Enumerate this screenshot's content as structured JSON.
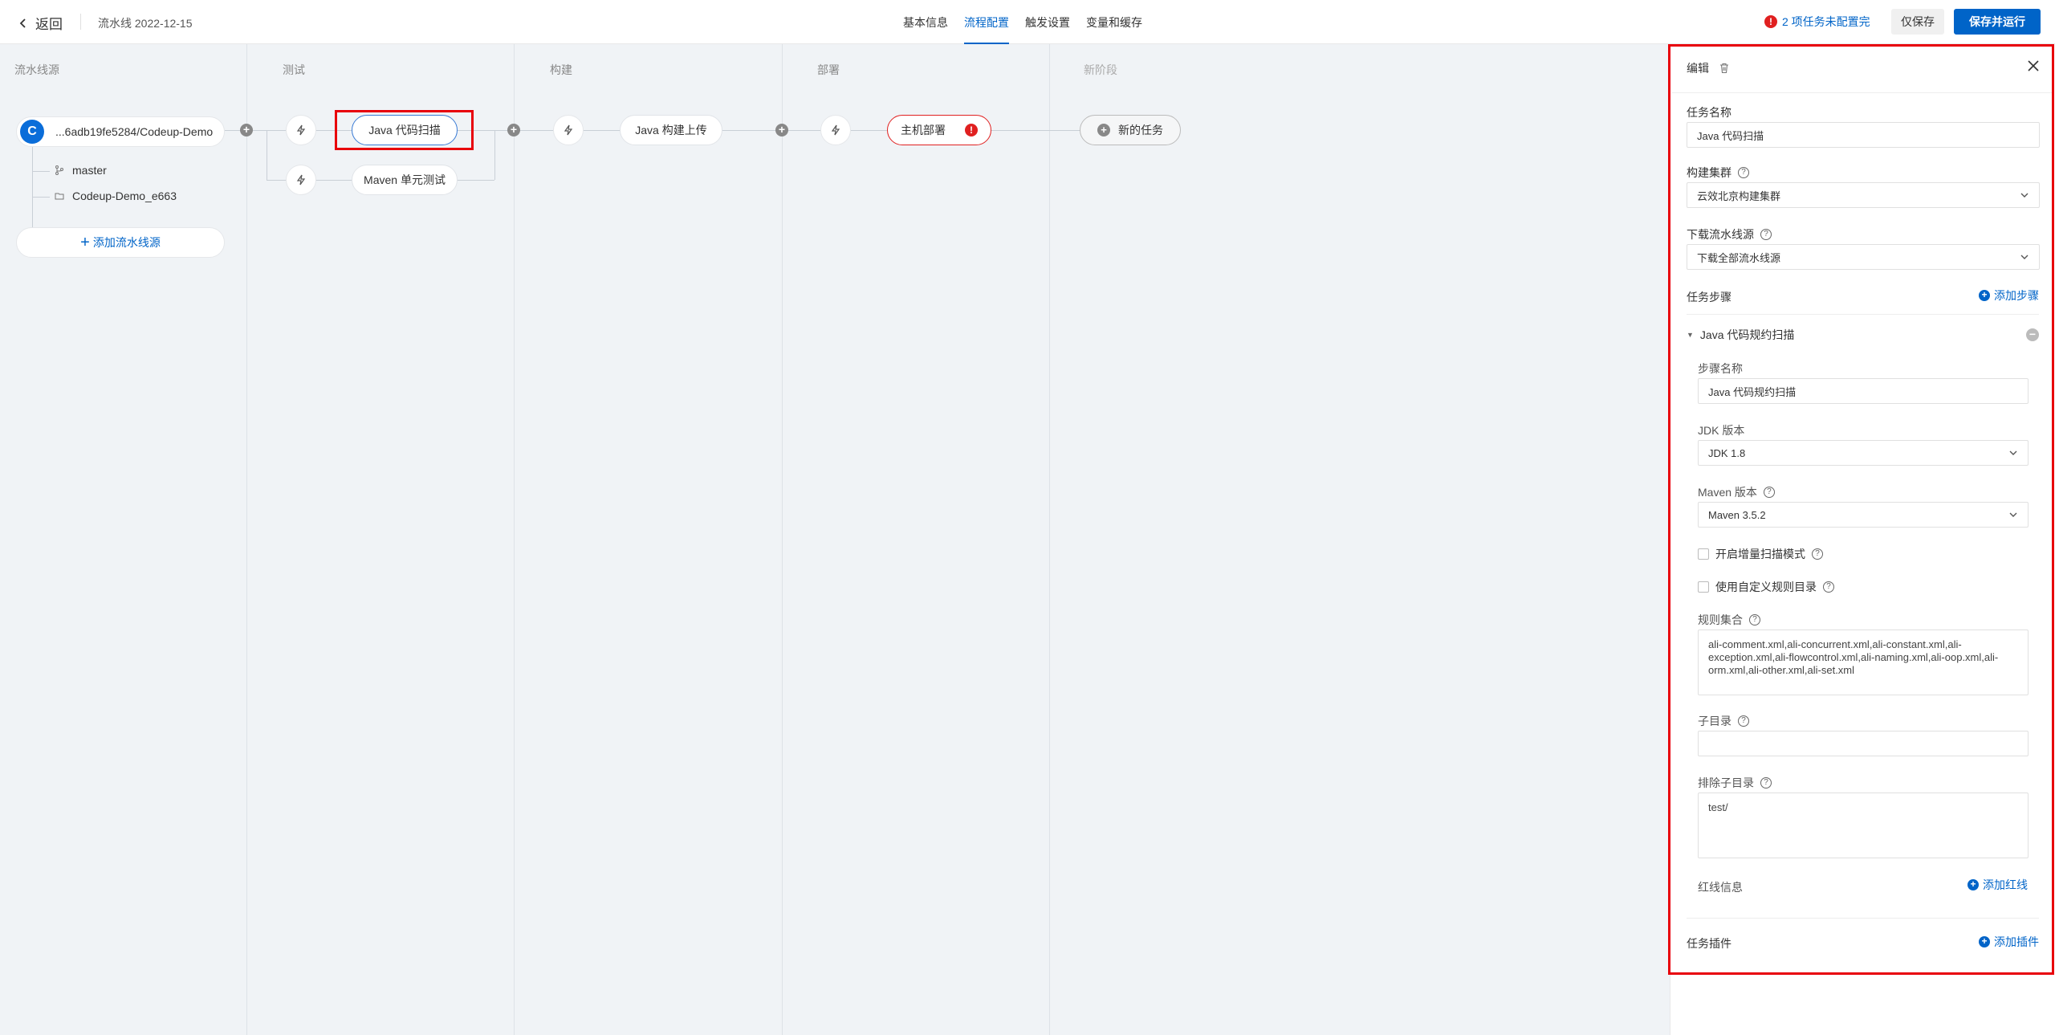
{
  "header": {
    "back_label": "返回",
    "pipeline_name": "流水线 2022-12-15",
    "tabs": [
      {
        "label": "基本信息"
      },
      {
        "label": "流程配置"
      },
      {
        "label": "触发设置"
      },
      {
        "label": "变量和缓存"
      }
    ],
    "active_tab": "流程配置",
    "warning_text": "2 项任务未配置完",
    "warning_icon": "!",
    "save_label": "仅保存",
    "save_run_label": "保存并运行"
  },
  "canvas": {
    "stages": [
      {
        "title": "流水线源"
      },
      {
        "title": "测试"
      },
      {
        "title": "构建"
      },
      {
        "title": "部署"
      },
      {
        "title": "新阶段"
      }
    ],
    "source": {
      "label": "...6adb19fe5284/Codeup-Demo",
      "branch": "master",
      "folder": "Codeup-Demo_e663",
      "add_label": "添加流水线源"
    },
    "tasks": {
      "test_1": "Java 代码扫描",
      "test_2": "Maven 单元测试",
      "build_1": "Java 构建上传",
      "deploy_1": "主机部署",
      "deploy_error": "!",
      "new_task": "新的任务"
    }
  },
  "panel": {
    "title": "编辑",
    "task_name_label": "任务名称",
    "task_name_value": "Java 代码扫描",
    "cluster_label": "构建集群",
    "cluster_value": "云效北京构建集群",
    "download_label": "下载流水线源",
    "download_value": "下载全部流水线源",
    "steps_label": "任务步骤",
    "add_step_label": "添加步骤",
    "step_title": "Java 代码规约扫描",
    "step_name_label": "步骤名称",
    "step_name_value": "Java 代码规约扫描",
    "jdk_label": "JDK 版本",
    "jdk_value": "JDK 1.8",
    "maven_label": "Maven 版本",
    "maven_value": "Maven 3.5.2",
    "incremental_label": "开启增量扫描模式",
    "incremental_checked": false,
    "custom_rules_label": "使用自定义规则目录",
    "custom_rules_checked": false,
    "rules_label": "规则集合",
    "rules_value": "ali-comment.xml,ali-concurrent.xml,ali-constant.xml,ali-exception.xml,ali-flowcontrol.xml,ali-naming.xml,ali-oop.xml,ali-orm.xml,ali-other.xml,ali-set.xml",
    "subdir_label": "子目录",
    "subdir_value": "",
    "exclude_label": "排除子目录",
    "exclude_value": "test/",
    "redline_label": "红线信息",
    "add_redline_label": "添加红线",
    "plugins_label": "任务插件",
    "add_plugin_label": "添加插件"
  },
  "colors": {
    "accent": "#0064c8",
    "error": "#e02020",
    "highlight_box": "#e8000b",
    "canvas_bg": "#f0f3f6"
  }
}
